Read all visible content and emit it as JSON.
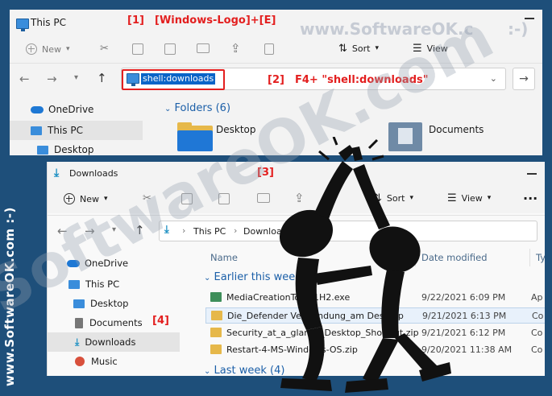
{
  "annotations": {
    "a1_num": "[1]",
    "a1_text": "[Windows-Logo]+[E]",
    "a2_num": "[2]",
    "a2_text": "F4+ \"shell:downloads\"",
    "a3": "[3]",
    "a4": "[4]"
  },
  "watermark": {
    "top": "www.SoftwareOK.c",
    "top_smiley": ":-)",
    "vertical": "www.SoftwareOK.com :-)",
    "diagonal": "SoftwareOK.com"
  },
  "win1": {
    "title": "This PC",
    "toolbar": {
      "new_label": "New",
      "sort_label": "Sort",
      "view_label": "View"
    },
    "address_value": "shell:downloads",
    "sidebar": [
      "OneDrive",
      "This PC",
      "Desktop"
    ],
    "folders_header": "Folders (6)",
    "folders": [
      "Desktop",
      "Documents"
    ]
  },
  "win2": {
    "title": "Downloads",
    "toolbar": {
      "new_label": "New",
      "sort_label": "Sort",
      "view_label": "View",
      "more_label": "···"
    },
    "breadcrumb": [
      "This PC",
      "Downloads"
    ],
    "sidebar": [
      "OneDrive",
      "This PC",
      "Desktop",
      "Documents",
      "Downloads",
      "Music"
    ],
    "columns": {
      "name": "Name",
      "date": "Date modified",
      "type": "Typ"
    },
    "groups": {
      "earlier": "Earlier this week",
      "last": "Last week (4)"
    },
    "files": [
      {
        "name": "MediaCreationTool21H2.exe",
        "date": "9/22/2021 6:09 PM",
        "type": "Ap"
      },
      {
        "name": "Die_Defender Verwendung_am Desktop",
        "date": "9/21/2021 6:13 PM",
        "type": "Co"
      },
      {
        "name": "Security_at_a_glance_Desktop_Shortcut.zip",
        "date": "9/21/2021 6:12 PM",
        "type": "Co"
      },
      {
        "name": "Restart-4-MS-Windows-OS.zip",
        "date": "9/20/2021 11:38 AM",
        "type": "Co"
      }
    ]
  }
}
